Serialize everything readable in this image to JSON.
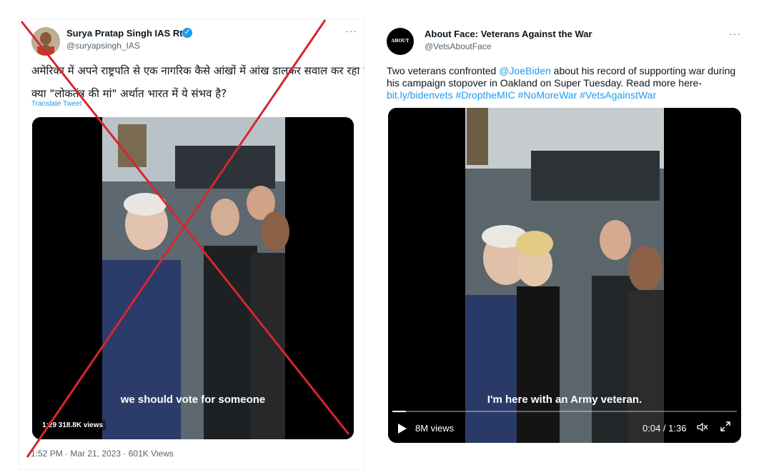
{
  "left_tweet": {
    "name": "Surya Pratap Singh IAS Rtd.",
    "verified": "✓",
    "handle": "@suryapsingh_IAS",
    "more": "···",
    "text_line1": "अमेरिका में अपने राष्ट्रपति से एक नागरिक कैसे आंखों में आंख डालकर सवाल कर रहा है।",
    "text_line2": "क्या \"लोकतंत्र की मां\" अर्थात भारत में ये संभव है?",
    "translate": "Translate Tweet",
    "video_caption": "we should vote for someone",
    "video_views": "1:29  318.8K views",
    "footer": "1:52 PM · Mar 21, 2023 · 601K Views"
  },
  "right_tweet": {
    "avatar_text": "ABOUT FACE",
    "name": "About Face: Veterans Against the War",
    "handle": "@VetsAboutFace",
    "more": "···",
    "text_a": "Two veterans confronted ",
    "mention": "@JoeBiden",
    "text_b": " about his record of supporting war during his campaign stopover in Oakland on Super Tuesday. Read more here- ",
    "link": "bit.ly/bidenvets",
    "hashtags": " #DroptheMIC #NoMoreWar #VetsAgainstWar",
    "video_caption": "I'm here with an Army veteran.",
    "views": "8M views",
    "time": "0:04 / 1:36",
    "progress": 0.04,
    "mute_icon": "muted-speaker-icon",
    "fullscreen_icon": "fullscreen-icon"
  },
  "colors": {
    "link": "#1d9bf0",
    "cross": "#d7262e"
  }
}
